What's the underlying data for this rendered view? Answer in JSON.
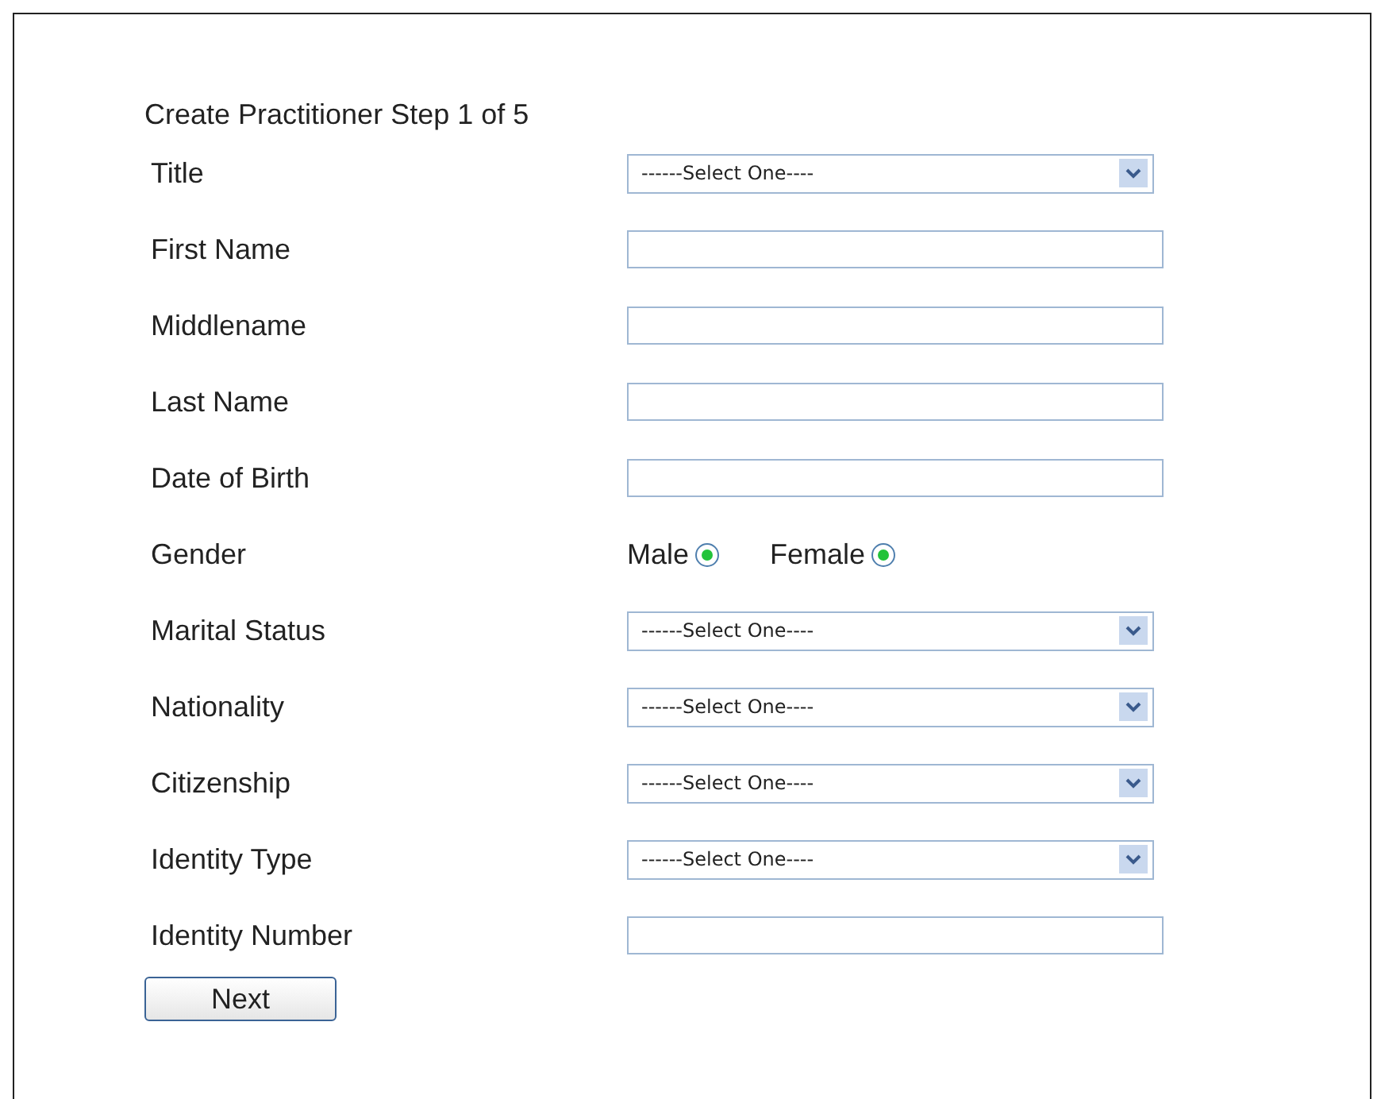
{
  "heading": "Create Practitioner Step 1 of 5",
  "fields": [
    {
      "kind": "select",
      "label": "Title",
      "value": "------Select One----"
    },
    {
      "kind": "text",
      "label": "First Name"
    },
    {
      "kind": "text",
      "label": "Middlename"
    },
    {
      "kind": "text",
      "label": "Last Name"
    },
    {
      "kind": "text",
      "label": "Date of Birth"
    },
    {
      "kind": "radio",
      "label": "Gender",
      "options": [
        {
          "label": "Male",
          "selected": true
        },
        {
          "label": "Female",
          "selected": true
        }
      ]
    },
    {
      "kind": "select",
      "label": "Marital Status",
      "value": "------Select One----"
    },
    {
      "kind": "select",
      "label": "Nationality",
      "value": "------Select One----"
    },
    {
      "kind": "select",
      "label": "Citizenship",
      "value": "------Select One----"
    },
    {
      "kind": "select",
      "label": "Identity Type",
      "value": "------Select One----"
    },
    {
      "kind": "text",
      "label": "Identity Number"
    }
  ],
  "button": "Next"
}
